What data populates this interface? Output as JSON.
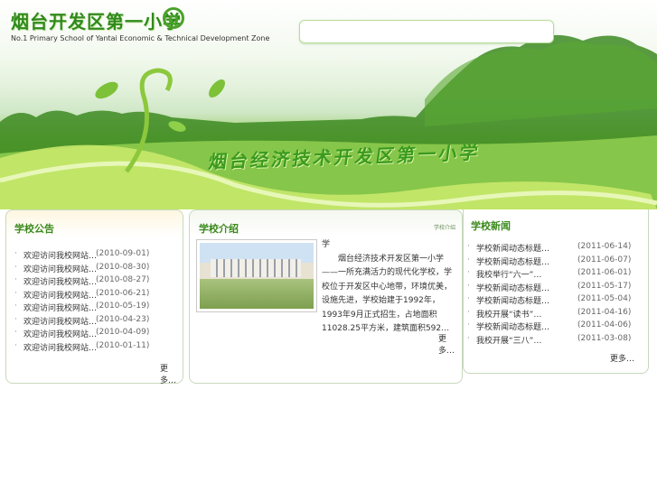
{
  "header": {
    "logo_text": "烟台开发区第一小学",
    "logo_mark": "Q",
    "logo_subtitle": "No.1 Primary School of Yantai Economic & Technical Development Zone",
    "banner_title": "烟台经济技术开发区第一小学"
  },
  "announcements": {
    "title": "学校公告",
    "items": [
      {
        "title": "欢迎访问我校网站…",
        "date": "(2010-09-01)"
      },
      {
        "title": "欢迎访问我校网站…",
        "date": "(2010-08-30)"
      },
      {
        "title": "欢迎访问我校网站…",
        "date": "(2010-08-27)"
      },
      {
        "title": "欢迎访问我校网站…",
        "date": "(2010-06-21)"
      },
      {
        "title": "欢迎访问我校网站…",
        "date": "(2010-05-19)"
      },
      {
        "title": "欢迎访问我校网站…",
        "date": "(2010-04-23)"
      },
      {
        "title": "欢迎访问我校网站…",
        "date": "(2010-04-09)"
      },
      {
        "title": "欢迎访问我校网站…",
        "date": "(2010-01-11)"
      }
    ],
    "more": "更多…"
  },
  "intro": {
    "title": "学校介绍",
    "small_mark": "学校介绍",
    "line0": "学",
    "body": "　　烟台经济技术开发区第一小学——一所充满活力的现代化学校，学校位于开发区中心地带，环境优美，设施先进，学校始建于1992年，1993年9月正式招生，占地面积11028.25平方米，建筑面积592…",
    "more": "更多…"
  },
  "news": {
    "title": "学校新闻",
    "items": [
      {
        "title": "学校新闻动态标题…",
        "date": "(2011-06-14)"
      },
      {
        "title": "学校新闻动态标题…",
        "date": "(2011-06-07)"
      },
      {
        "title": "我校举行“六一”…",
        "date": "(2011-06-01)"
      },
      {
        "title": "学校新闻动态标题…",
        "date": "(2011-05-17)"
      },
      {
        "title": "学校新闻动态标题…",
        "date": "(2011-05-04)"
      },
      {
        "title": "我校开展“读书”…",
        "date": "(2011-04-16)"
      },
      {
        "title": "学校新闻动态标题…",
        "date": "(2011-04-06)"
      },
      {
        "title": "我校开展“三八”…",
        "date": "(2011-03-08)"
      }
    ],
    "more": "更多…"
  }
}
